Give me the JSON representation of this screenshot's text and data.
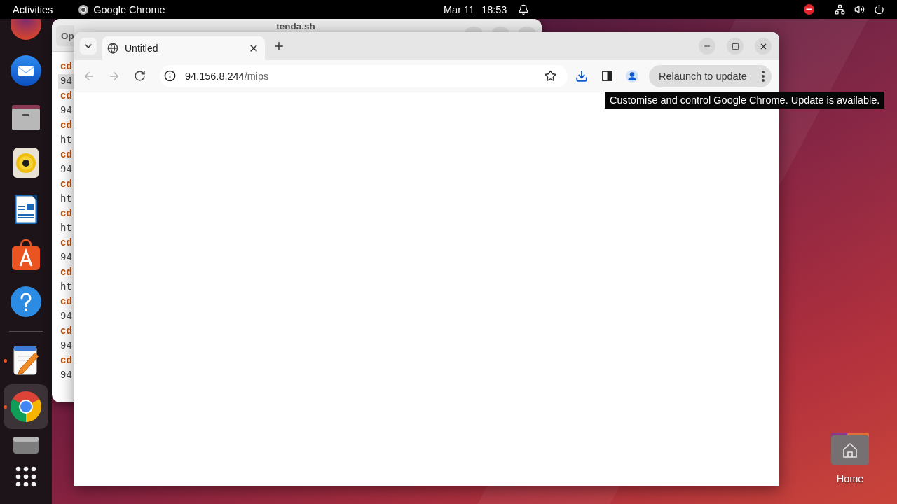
{
  "top_bar": {
    "activities": "Activities",
    "app_name": "Google Chrome",
    "date": "Mar 11",
    "time": "18:53"
  },
  "dock": {
    "pinned": [
      {
        "kind": "partial",
        "running": false,
        "focused": false
      },
      {
        "kind": "mail",
        "running": false,
        "focused": false
      },
      {
        "kind": "files",
        "running": false,
        "focused": false
      },
      {
        "kind": "music",
        "running": false,
        "focused": false
      },
      {
        "kind": "writer",
        "running": false,
        "focused": false
      },
      {
        "kind": "store",
        "running": false,
        "focused": false
      },
      {
        "kind": "help",
        "running": false,
        "focused": false
      }
    ],
    "others": [
      {
        "kind": "editor",
        "running": true,
        "focused": false
      },
      {
        "kind": "chrome",
        "running": true,
        "focused": true
      },
      {
        "kind": "drive",
        "running": false,
        "focused": false
      },
      {
        "kind": "grid",
        "running": false,
        "focused": false
      }
    ]
  },
  "editor": {
    "open_button": "Op",
    "title": "tenda.sh",
    "lines": [
      {
        "text": "cd",
        "kind": "keyword",
        "current": false
      },
      {
        "text": "94",
        "kind": "plain",
        "current": true
      },
      {
        "text": "cd",
        "kind": "keyword",
        "current": false
      },
      {
        "text": "94",
        "kind": "plain",
        "current": false
      },
      {
        "text": "cd",
        "kind": "keyword",
        "current": false
      },
      {
        "text": "ht",
        "kind": "plain",
        "current": false
      },
      {
        "text": "cd",
        "kind": "keyword",
        "current": false
      },
      {
        "text": "94",
        "kind": "plain",
        "current": false
      },
      {
        "text": "cd",
        "kind": "keyword",
        "current": false
      },
      {
        "text": "ht",
        "kind": "plain",
        "current": false
      },
      {
        "text": "cd",
        "kind": "keyword",
        "current": false
      },
      {
        "text": "ht",
        "kind": "plain",
        "current": false
      },
      {
        "text": "cd",
        "kind": "keyword",
        "current": false
      },
      {
        "text": "94",
        "kind": "plain",
        "current": false
      },
      {
        "text": "cd",
        "kind": "keyword",
        "current": false
      },
      {
        "text": "ht",
        "kind": "plain",
        "current": false
      },
      {
        "text": "cd",
        "kind": "keyword",
        "current": false
      },
      {
        "text": "94",
        "kind": "plain",
        "current": false
      },
      {
        "text": "cd",
        "kind": "keyword",
        "current": false
      },
      {
        "text": "94",
        "kind": "plain",
        "current": false
      },
      {
        "text": "cd",
        "kind": "keyword",
        "current": false
      },
      {
        "text": "94",
        "kind": "plain",
        "current": false
      }
    ]
  },
  "browser": {
    "tabs": [
      {
        "title": "Untitled",
        "selected": true
      }
    ],
    "back": {
      "disabled": true
    },
    "forward": {
      "disabled": true
    },
    "address": {
      "host": "94.156.8.244",
      "path": "/mips"
    },
    "bookmarked": false,
    "relaunch_button": "Relaunch to update",
    "tooltip": "Customise and control Google Chrome. Update is available."
  },
  "desktop_icons": [
    {
      "label": "Home",
      "kind": "home"
    }
  ]
}
